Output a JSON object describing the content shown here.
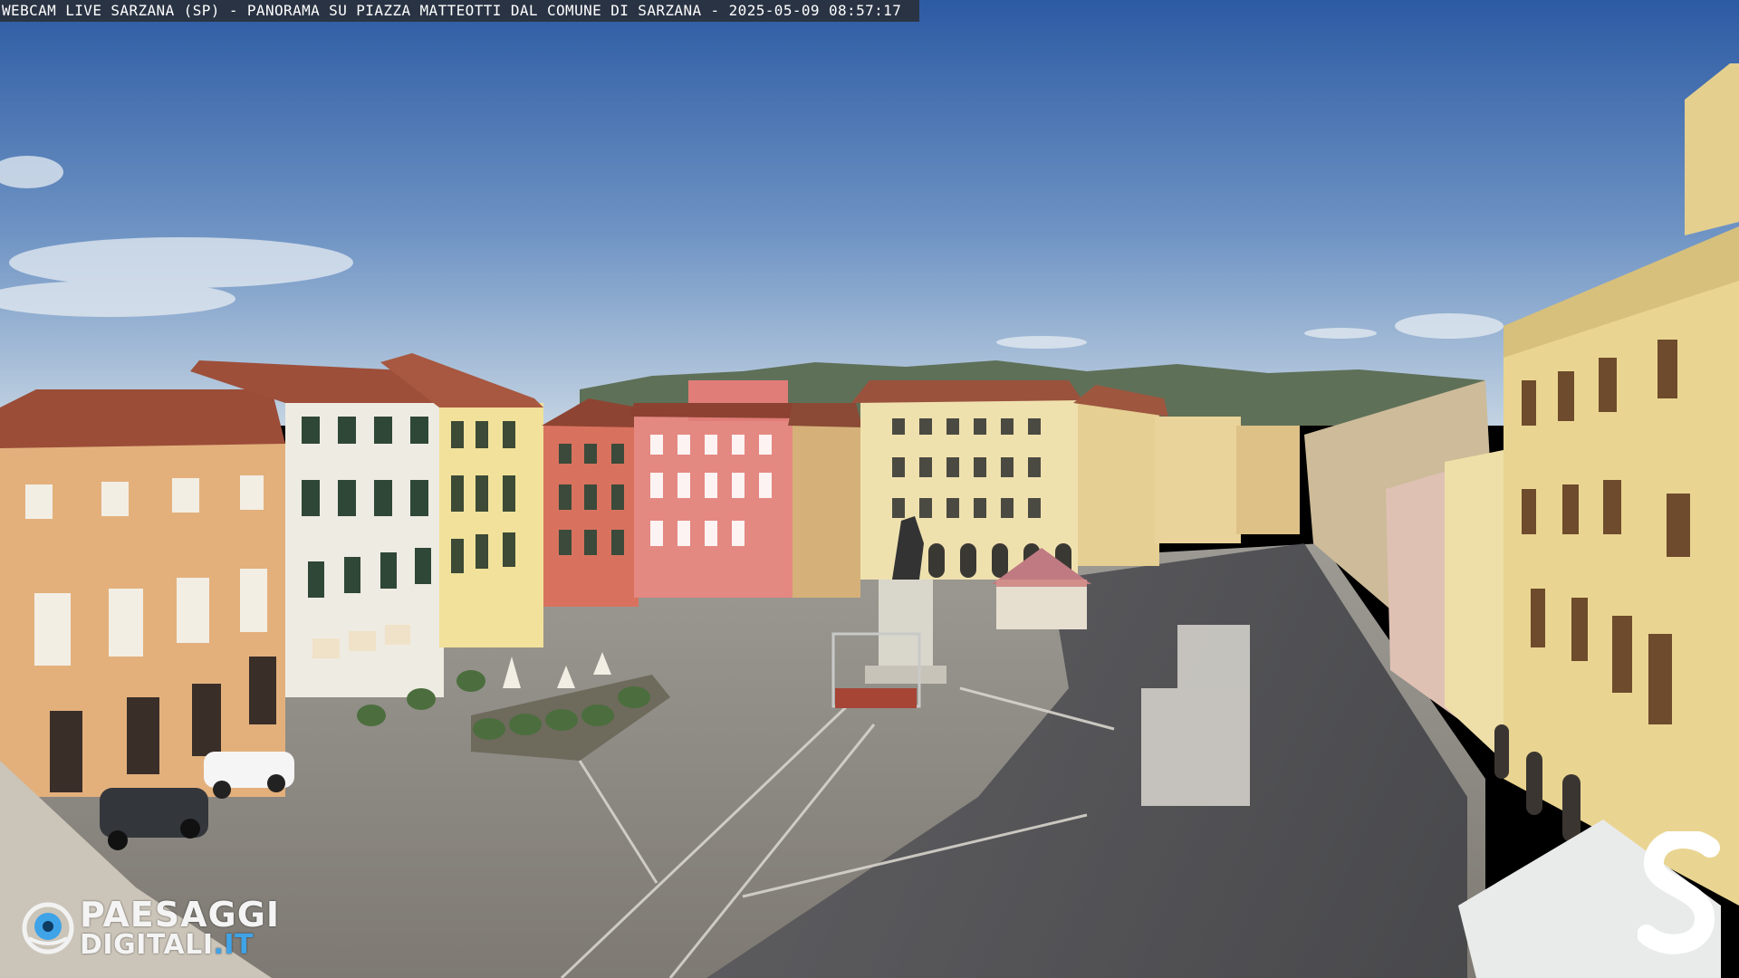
{
  "overlay": {
    "caption": "WEBCAM LIVE SARZANA (SP) - PANORAMA SU PIAZZA MATTEOTTI DAL COMUNE DI SARZANA - 2025-05-09  08:57:17"
  },
  "watermark_left": {
    "line1": "PAESAGGI",
    "line2_main": "DIGITALI",
    "line2_suffix": ".IT",
    "icon": "eye-logo-icon"
  },
  "watermark_right": {
    "letter": "S",
    "icon": "s-logo-icon"
  },
  "colors": {
    "sky_top": "#2f5fa8",
    "sky_bottom": "#b9cde0",
    "pavement": "#8c8880",
    "shadow": "#4b4b4f",
    "accent_logo": "#3fa3e8"
  }
}
